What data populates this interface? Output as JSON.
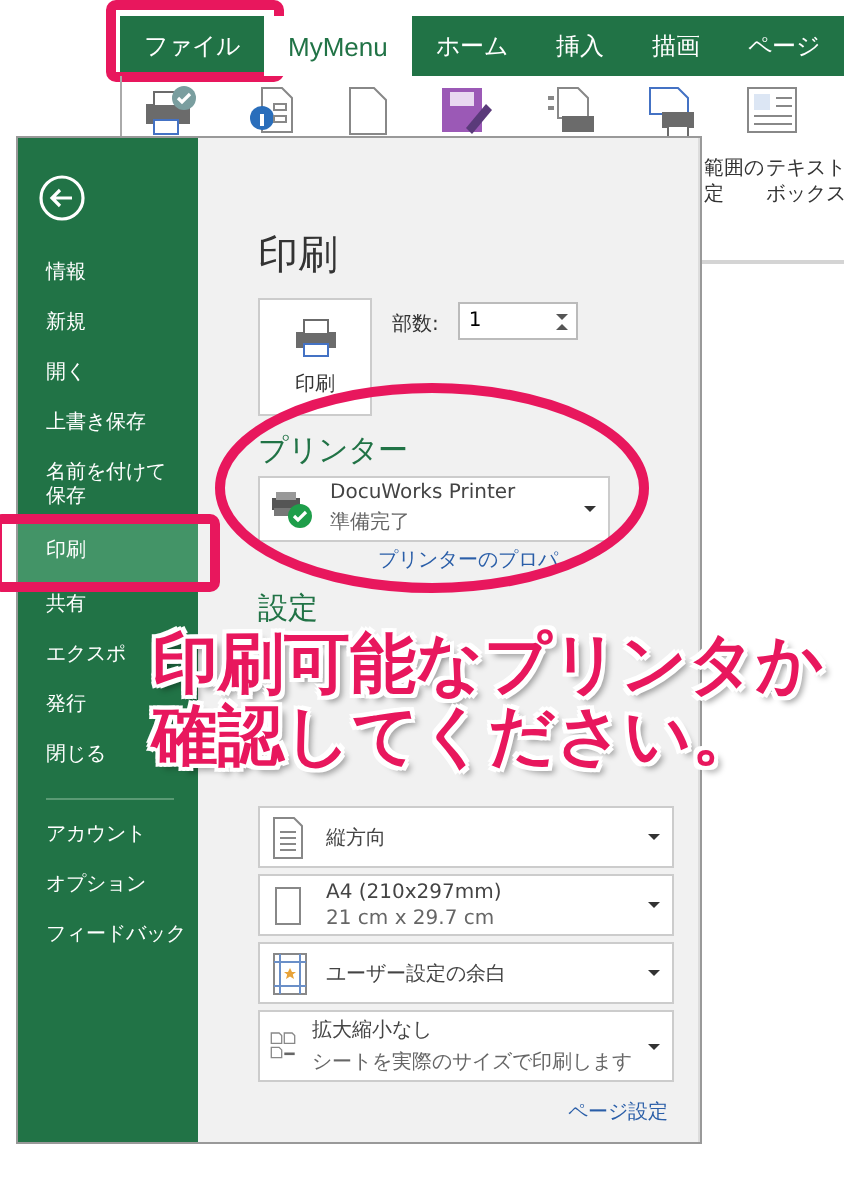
{
  "ribbon": {
    "tabs": [
      {
        "label": "ファイル",
        "selected": false,
        "highlighted": true
      },
      {
        "label": "MyMenu",
        "selected": true,
        "highlighted": false
      },
      {
        "label": "ホーム",
        "selected": false,
        "highlighted": false
      },
      {
        "label": "挿入",
        "selected": false,
        "highlighted": false
      },
      {
        "label": "描画",
        "selected": false,
        "highlighted": false
      },
      {
        "label": "ページ",
        "selected": false,
        "highlighted": false
      }
    ],
    "commands": [
      {
        "lines": [
          "範囲の",
          "定"
        ]
      },
      {
        "lines": [
          "テキスト",
          "ボックス"
        ]
      }
    ]
  },
  "sidebar": {
    "items": [
      {
        "label": "情報",
        "selected": false,
        "highlighted": false
      },
      {
        "label": "新規",
        "selected": false,
        "highlighted": false
      },
      {
        "label": "開く",
        "selected": false,
        "highlighted": false
      },
      {
        "label": "上書き保存",
        "selected": false,
        "highlighted": false
      },
      {
        "label": "名前を付けて保存",
        "selected": false,
        "highlighted": false
      },
      {
        "label": "印刷",
        "selected": true,
        "highlighted": true
      },
      {
        "label": "共有",
        "selected": false,
        "highlighted": false
      },
      {
        "label": "エクスポ",
        "selected": false,
        "highlighted": false
      },
      {
        "label": "発行",
        "selected": false,
        "highlighted": false
      },
      {
        "label": "閉じる",
        "selected": false,
        "highlighted": false
      }
    ],
    "footer_items": [
      {
        "label": "アカウント",
        "selected": false
      },
      {
        "label": "オプション",
        "selected": false
      },
      {
        "label": "フィードバック",
        "selected": false
      }
    ]
  },
  "print": {
    "title": "印刷",
    "print_button": "印刷",
    "copies_label": "部数:",
    "copies_value": "1",
    "printer_heading": "プリンター",
    "printer_name": "DocuWorks Printer",
    "printer_status": "準備完了",
    "printer_ready": true,
    "printer_properties": "プリンターのプロパ",
    "settings_heading": "設定",
    "settings": [
      {
        "kind": "orientation",
        "text": "縦方向"
      },
      {
        "kind": "paper",
        "text": "A4 (210x297mm)",
        "subtext": "21 cm x 29.7 cm"
      },
      {
        "kind": "margins",
        "text": "ユーザー設定の余白"
      },
      {
        "kind": "scaling",
        "text": "拡大縮小なし",
        "subtext": "シートを実際のサイズで印刷します"
      }
    ],
    "page_setup": "ページ設定"
  },
  "annotation": {
    "lines": [
      "印刷可能なプリンタか",
      "確認してください。"
    ],
    "ellipse": true
  }
}
